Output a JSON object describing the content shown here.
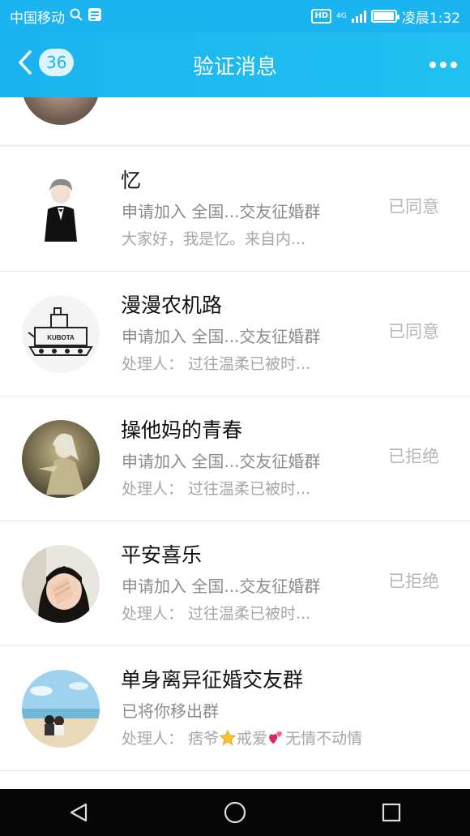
{
  "status_bar": {
    "carrier": "中国移动",
    "network": "HD",
    "net_type": "4G",
    "time": "凌晨1:32",
    "battery_level": 0.9
  },
  "nav": {
    "back_count": "36",
    "title": "验证消息"
  },
  "items": [
    {
      "name": "忆",
      "line1": "申请加入 全国...交友征婚群",
      "line2": "大家好，我是忆。来自内...",
      "status": "已同意",
      "avatar": "boy-in-suit"
    },
    {
      "name": "漫漫农机路",
      "line1": "申请加入 全国...交友征婚群",
      "line2": "处理人：  过往温柔已被时...",
      "status": "已同意",
      "avatar": "kubota-machine",
      "avatar_text": "KUBOTA"
    },
    {
      "name": "操他妈的青春",
      "line1": "申请加入 全国...交友征婚群",
      "line2": "处理人：  过往温柔已被时...",
      "status": "已拒绝",
      "avatar": "anime-warrior"
    },
    {
      "name": "平安喜乐",
      "line1": "申请加入 全国...交友征婚群",
      "line2": "处理人：  过往温柔已被时...",
      "status": "已拒绝",
      "avatar": "girl-covering-face"
    },
    {
      "name": "单身离异征婚交友群",
      "line1": "已将你移出群",
      "line2_prefix": "处理人：  痞爷",
      "line2_mid": "戒爱",
      "line2_suffix": "无情不动情",
      "status": "",
      "avatar": "beach-couple"
    }
  ],
  "system_nav": {
    "icons": [
      "back-triangle-icon",
      "home-circle-icon",
      "recents-square-icon"
    ]
  }
}
